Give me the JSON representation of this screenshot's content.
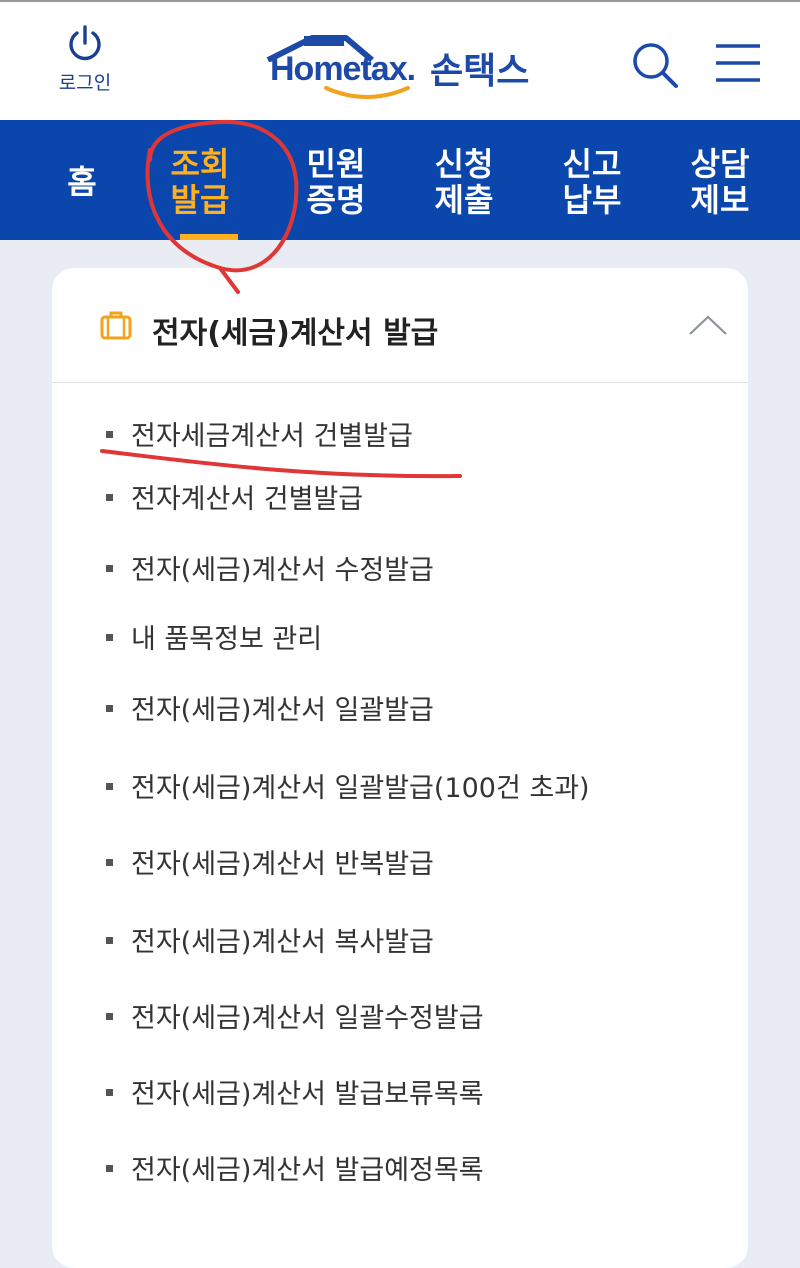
{
  "header": {
    "login_label": "로그인",
    "logo_home": "Hometax.",
    "logo_korean": "손택스"
  },
  "nav": {
    "items": [
      {
        "label": "홈",
        "active": false
      },
      {
        "label": "조회\n발급",
        "active": true
      },
      {
        "label": "민원\n증명",
        "active": false
      },
      {
        "label": "신청\n제출",
        "active": false
      },
      {
        "label": "신고\n납부",
        "active": false
      },
      {
        "label": "상담\n제보",
        "active": false
      }
    ],
    "active_color": "#ffb020",
    "bg_color": "#0b46ad"
  },
  "section": {
    "title": "전자(세금)계산서 발급",
    "expanded": true,
    "items": [
      "전자세금계산서 건별발급",
      "전자계산서 건별발급",
      "전자(세금)계산서 수정발급",
      "내 품목정보 관리",
      "전자(세금)계산서 일괄발급",
      "전자(세금)계산서 일괄발급(100건 초과)",
      "전자(세금)계산서 반복발급",
      "전자(세금)계산서 복사발급",
      "전자(세금)계산서 일괄수정발급",
      "전자(세금)계산서 발급보류목록",
      "전자(세금)계산서 발급예정목록"
    ]
  },
  "icons": {
    "login": "power-icon",
    "search": "search-icon",
    "menu": "hamburger-icon",
    "section": "briefcase-icon",
    "collapse": "chevron-up-icon"
  }
}
